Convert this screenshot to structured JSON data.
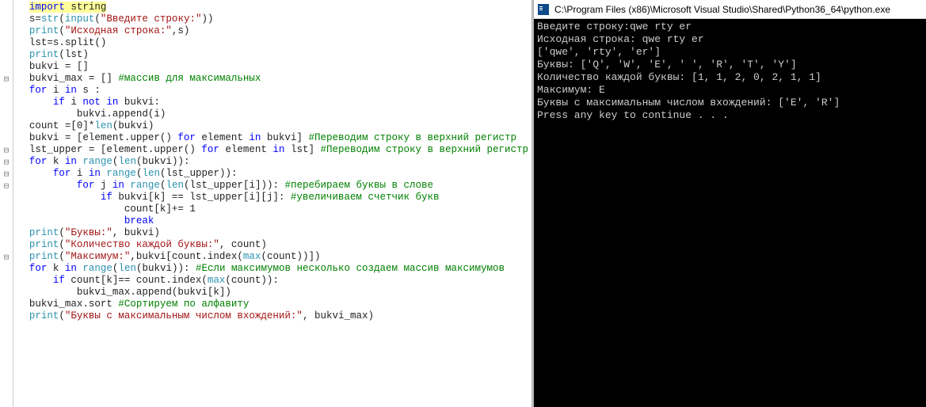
{
  "editor": {
    "fold_marks": [
      "",
      "",
      "",
      "",
      "",
      "",
      "⊟",
      "",
      "",
      "",
      "",
      "",
      "⊟",
      "⊟",
      "⊟",
      "⊟",
      "",
      "",
      "",
      "",
      "",
      "⊟",
      "",
      "",
      "",
      "",
      ""
    ],
    "lines": [
      [
        [
          "kw",
          "import"
        ],
        [
          "plain",
          " string"
        ]
      ],
      [
        [
          "plain",
          "s="
        ],
        [
          "builtin",
          "str"
        ],
        [
          "plain",
          "("
        ],
        [
          "builtin",
          "input"
        ],
        [
          "plain",
          "("
        ],
        [
          "str",
          "\"Введите строку:\""
        ],
        [
          "plain",
          "))"
        ]
      ],
      [
        [
          "builtin",
          "print"
        ],
        [
          "plain",
          "("
        ],
        [
          "str",
          "\"Исходная строка:\""
        ],
        [
          "plain",
          ",s)"
        ]
      ],
      [
        [
          "plain",
          "lst=s.split()"
        ]
      ],
      [
        [
          "builtin",
          "print"
        ],
        [
          "plain",
          "(lst)"
        ]
      ],
      [
        [
          "plain",
          "bukvi = []"
        ]
      ],
      [
        [
          "plain",
          "bukvi_max = [] "
        ],
        [
          "com",
          "#массив для максимальных"
        ]
      ],
      [
        [
          "kw",
          "for"
        ],
        [
          "plain",
          " i "
        ],
        [
          "kw",
          "in"
        ],
        [
          "plain",
          " s :"
        ]
      ],
      [
        [
          "plain",
          "    "
        ],
        [
          "kw",
          "if"
        ],
        [
          "plain",
          " i "
        ],
        [
          "kw",
          "not in"
        ],
        [
          "plain",
          " bukvi:"
        ]
      ],
      [
        [
          "plain",
          "        bukvi.append(i)"
        ]
      ],
      [
        [
          "plain",
          "count =[0]*"
        ],
        [
          "builtin",
          "len"
        ],
        [
          "plain",
          "(bukvi)"
        ]
      ],
      [
        [
          "plain",
          "bukvi = [element.upper() "
        ],
        [
          "kw",
          "for"
        ],
        [
          "plain",
          " element "
        ],
        [
          "kw",
          "in"
        ],
        [
          "plain",
          " bukvi] "
        ],
        [
          "com",
          "#Переводим строку в верхний регистр"
        ]
      ],
      [
        [
          "plain",
          "lst_upper = [element.upper() "
        ],
        [
          "kw",
          "for"
        ],
        [
          "plain",
          " element "
        ],
        [
          "kw",
          "in"
        ],
        [
          "plain",
          " lst] "
        ],
        [
          "com",
          "#Переводим строку в верхний регистр"
        ]
      ],
      [
        [
          "kw",
          "for"
        ],
        [
          "plain",
          " k "
        ],
        [
          "kw",
          "in"
        ],
        [
          "plain",
          " "
        ],
        [
          "builtin",
          "range"
        ],
        [
          "plain",
          "("
        ],
        [
          "builtin",
          "len"
        ],
        [
          "plain",
          "(bukvi)):"
        ]
      ],
      [
        [
          "plain",
          "    "
        ],
        [
          "kw",
          "for"
        ],
        [
          "plain",
          " i "
        ],
        [
          "kw",
          "in"
        ],
        [
          "plain",
          " "
        ],
        [
          "builtin",
          "range"
        ],
        [
          "plain",
          "("
        ],
        [
          "builtin",
          "len"
        ],
        [
          "plain",
          "(lst_upper)):"
        ]
      ],
      [
        [
          "plain",
          "        "
        ],
        [
          "kw",
          "for"
        ],
        [
          "plain",
          " j "
        ],
        [
          "kw",
          "in"
        ],
        [
          "plain",
          " "
        ],
        [
          "builtin",
          "range"
        ],
        [
          "plain",
          "("
        ],
        [
          "builtin",
          "len"
        ],
        [
          "plain",
          "(lst_upper[i])): "
        ],
        [
          "com",
          "#перебираем буквы в слове"
        ]
      ],
      [
        [
          "plain",
          "            "
        ],
        [
          "kw",
          "if"
        ],
        [
          "plain",
          " bukvi[k] == lst_upper[i][j]: "
        ],
        [
          "com",
          "#увеличиваем счетчик букв"
        ]
      ],
      [
        [
          "plain",
          "                count[k]+= 1"
        ]
      ],
      [
        [
          "plain",
          "                "
        ],
        [
          "kw",
          "break"
        ]
      ],
      [
        [
          "builtin",
          "print"
        ],
        [
          "plain",
          "("
        ],
        [
          "str",
          "\"Буквы:\""
        ],
        [
          "plain",
          ", bukvi)"
        ]
      ],
      [
        [
          "builtin",
          "print"
        ],
        [
          "plain",
          "("
        ],
        [
          "str",
          "\"Количество каждой буквы:\""
        ],
        [
          "plain",
          ", count)"
        ]
      ],
      [
        [
          "builtin",
          "print"
        ],
        [
          "plain",
          "("
        ],
        [
          "str",
          "\"Максимум:\""
        ],
        [
          "plain",
          ",bukvi[count.index("
        ],
        [
          "builtin",
          "max"
        ],
        [
          "plain",
          "(count))])"
        ]
      ],
      [
        [
          "kw",
          "for"
        ],
        [
          "plain",
          " k "
        ],
        [
          "kw",
          "in"
        ],
        [
          "plain",
          " "
        ],
        [
          "builtin",
          "range"
        ],
        [
          "plain",
          "("
        ],
        [
          "builtin",
          "len"
        ],
        [
          "plain",
          "(bukvi)): "
        ],
        [
          "com",
          "#Если максимумов несколько создаем массив максимумов"
        ]
      ],
      [
        [
          "plain",
          "    "
        ],
        [
          "kw",
          "if"
        ],
        [
          "plain",
          " count[k]== count.index("
        ],
        [
          "builtin",
          "max"
        ],
        [
          "plain",
          "(count)):"
        ]
      ],
      [
        [
          "plain",
          "        bukvi_max.append(bukvi[k])"
        ]
      ],
      [
        [
          "plain",
          "bukvi_max.sort "
        ],
        [
          "com",
          "#Сортируем по алфавиту"
        ]
      ],
      [
        [
          "builtin",
          "print"
        ],
        [
          "plain",
          "("
        ],
        [
          "str",
          "\"Буквы с максимальным числом вхождений:\""
        ],
        [
          "plain",
          ", bukvi_max)"
        ]
      ]
    ],
    "highlight_line": 0
  },
  "console": {
    "title": "C:\\Program Files (x86)\\Microsoft Visual Studio\\Shared\\Python36_64\\python.exe",
    "output": [
      "Введите строку:qwe rty er",
      "Исходная строка: qwe rty er",
      "['qwe', 'rty', 'er']",
      "Буквы: ['Q', 'W', 'E', ' ', 'R', 'T', 'Y']",
      "Количество каждой буквы: [1, 1, 2, 0, 2, 1, 1]",
      "Максимум: E",
      "Буквы с максимальным числом вхождений: ['E', 'R']",
      "Press any key to continue . . ."
    ]
  }
}
